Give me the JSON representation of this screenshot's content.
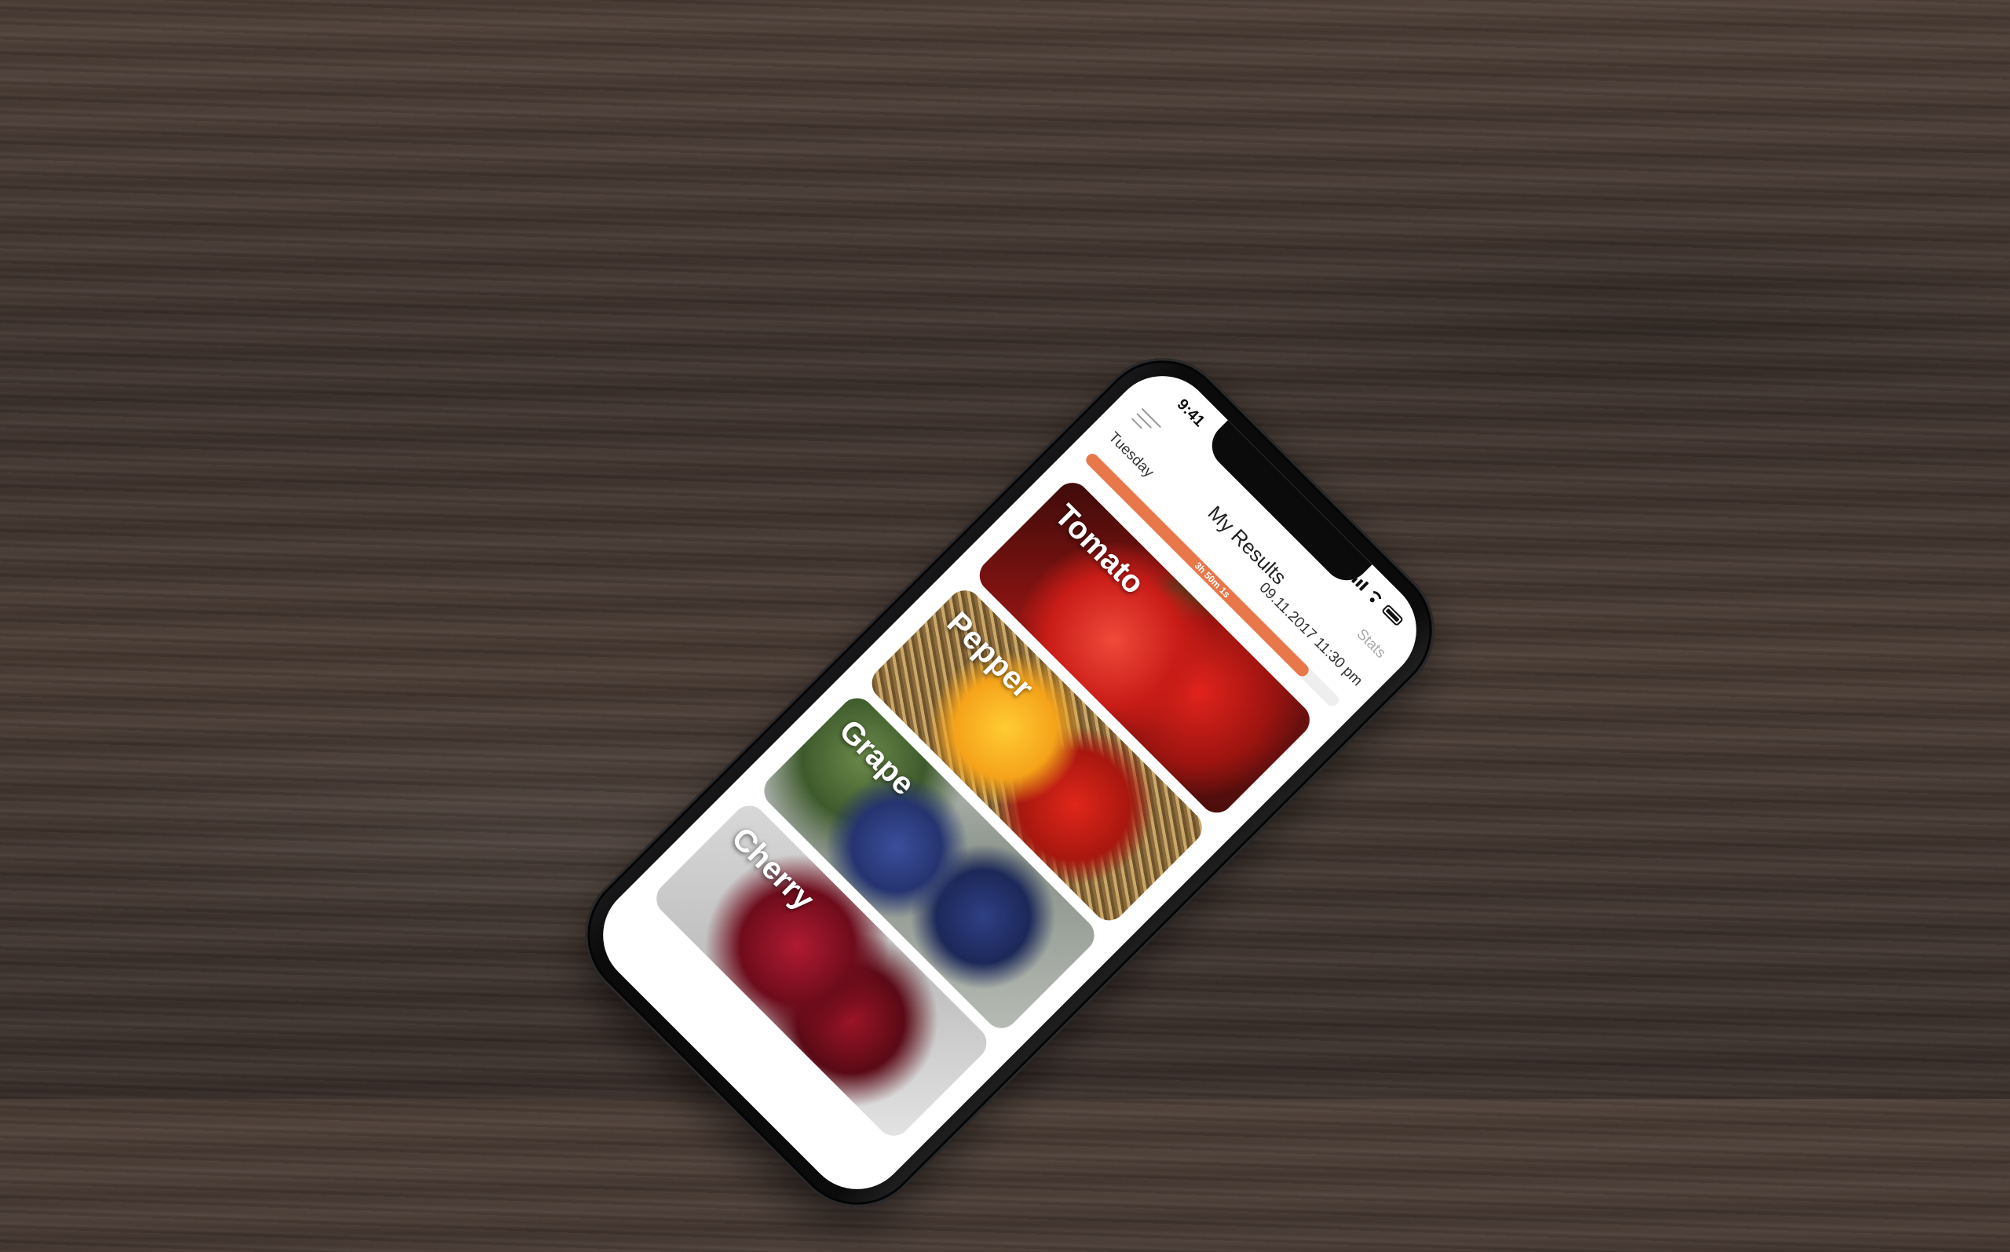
{
  "status_bar": {
    "time": "9:41"
  },
  "header": {
    "title": "My Results",
    "day": "Tuesday",
    "datetime": "09.11.2017  11:30 pm",
    "stats_link": "Stats"
  },
  "progress": {
    "label": "3h 50m 1s",
    "fraction": 0.88,
    "color": "#e8774a"
  },
  "cards": [
    {
      "label": "Tomato"
    },
    {
      "label": "Pepper"
    },
    {
      "label": "Grape"
    },
    {
      "label": "Cherry"
    }
  ],
  "icons": [
    "menu-icon",
    "signal-icon",
    "wifi-icon",
    "battery-icon"
  ]
}
